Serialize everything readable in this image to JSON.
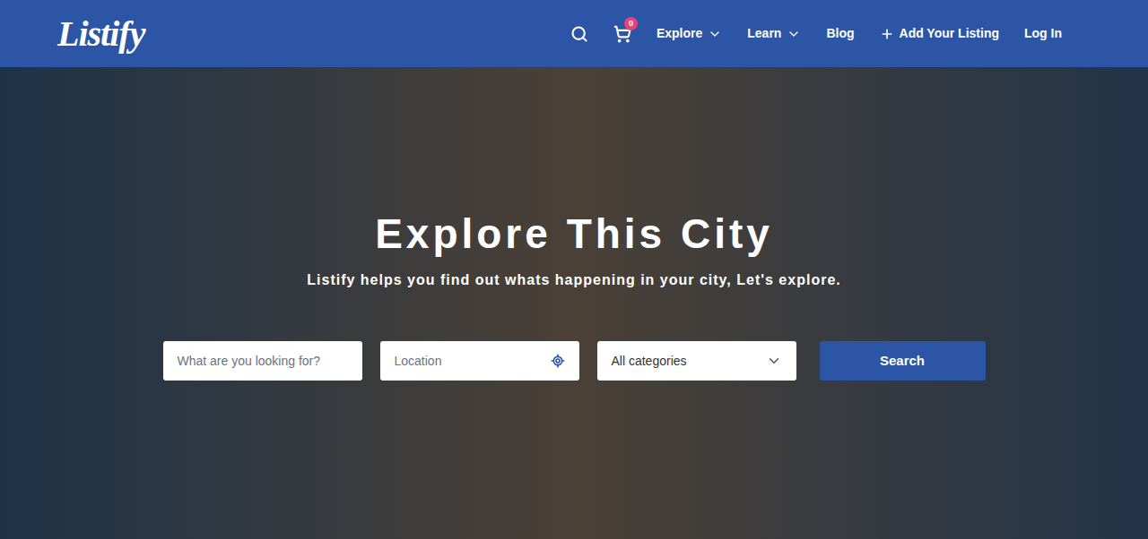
{
  "header": {
    "logo": "Listify",
    "cart_count": "0",
    "nav": [
      {
        "label": "Explore",
        "dropdown": true,
        "kind": "menu"
      },
      {
        "label": "Learn",
        "dropdown": true,
        "kind": "menu"
      },
      {
        "label": "Blog",
        "dropdown": false,
        "kind": "link"
      },
      {
        "label": "Add Your Listing",
        "dropdown": false,
        "kind": "add"
      },
      {
        "label": "Log In",
        "dropdown": false,
        "kind": "link"
      }
    ]
  },
  "hero": {
    "title": "Explore This City",
    "subtitle": "Listify helps you find out whats happening in your city, Let's explore."
  },
  "search": {
    "keyword_placeholder": "What are you looking for?",
    "location_placeholder": "Location",
    "category": "All categories",
    "button": "Search"
  }
}
